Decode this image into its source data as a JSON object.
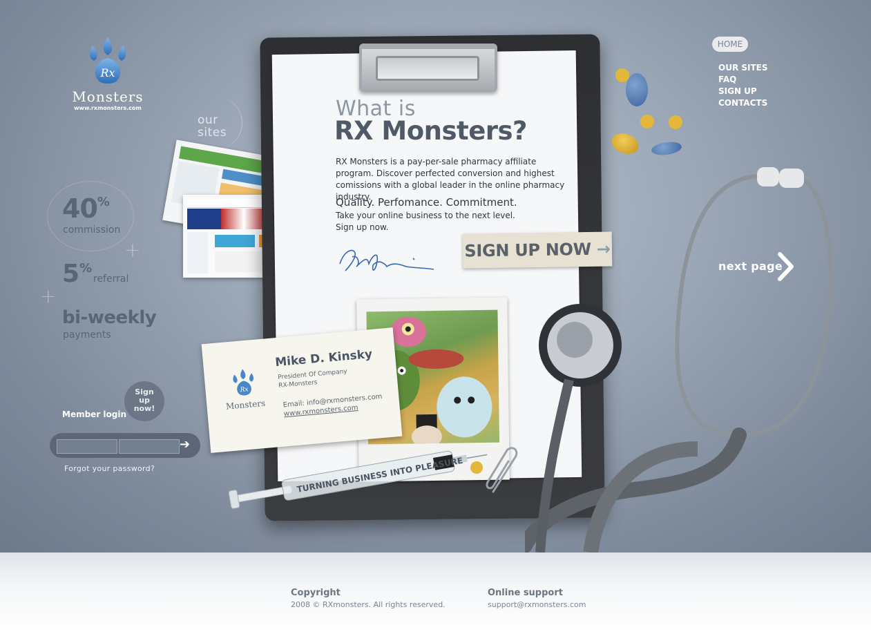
{
  "brand": {
    "name": "Monsters",
    "monogram": "Rx",
    "url": "www.rxmonsters.com"
  },
  "nav": {
    "home": "HOME",
    "items": [
      "OUR SITES",
      "FAQ",
      "SIGN UP",
      "CONTACTS"
    ],
    "next_page": "next page"
  },
  "sidebar": {
    "our_sites_line1": "our",
    "our_sites_line2": "sites",
    "stat_commission_value": "40",
    "stat_commission_unit": "%",
    "stat_commission_label": "commission",
    "stat_referral_value": "5",
    "stat_referral_unit": "%",
    "stat_referral_label": "referral",
    "stat_payments_value": "bi-weekly",
    "stat_payments_label": "payments"
  },
  "login": {
    "label": "Member login",
    "signup_line1": "Sign",
    "signup_line2": "up",
    "signup_line3": "now!",
    "forgot": "Forgot your password?",
    "submit_arrow": "➔"
  },
  "main": {
    "heading_small": "What is",
    "heading_large": "RX Monsters?",
    "intro": "RX Monsters is a pay-per-sale pharmacy affiliate program. Discover perfected conversion and highest comissions with a global leader in the online pharmacy industry.",
    "tagline": "Quality. Perfomance. Commitment.",
    "sub_line1": "Take your online business to the next level.",
    "sub_line2": "Sign up now.",
    "signup_button": "SIGN UP NOW",
    "signup_arrow": "→"
  },
  "card": {
    "name": "Mike D. Kinsky",
    "title_line1": "President Of Company",
    "title_line2": "RX-Monsters",
    "email": "Email: info@rxmonsters.com",
    "website": "www.rxmonsters.com",
    "logo_word": "Monsters"
  },
  "syringe": {
    "text": "TURNING BUSINESS INTO PLEASURE"
  },
  "footer": {
    "copyright_heading": "Copyright",
    "copyright_text": "2008 © RXmonsters. All rights reserved.",
    "support_heading": "Online support",
    "support_email": "support@rxmonsters.com"
  },
  "colors": {
    "background": "#9aa6b5",
    "clipboard": "#2e2f32",
    "paper": "#f6f7f8",
    "text_dark": "#2f3640",
    "accent_blue": "#4a7fc1",
    "pill_yellow": "#e2b73a",
    "pill_blue": "#5a7fb0"
  }
}
